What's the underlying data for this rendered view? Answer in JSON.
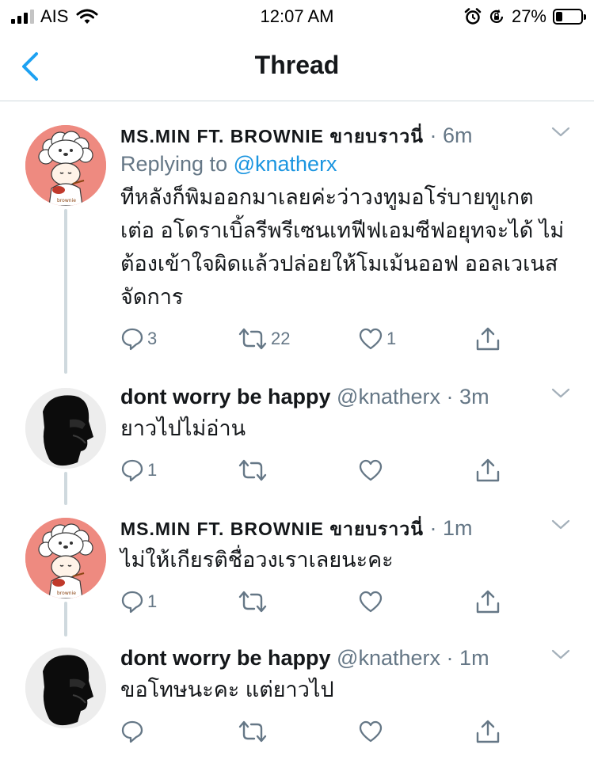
{
  "status_bar": {
    "carrier": "AIS",
    "time": "12:07 AM",
    "battery": "27%",
    "battery_level": 0.27
  },
  "nav": {
    "title": "Thread"
  },
  "tweets": [
    {
      "name": "MS.MIN FT. BROWNIE ขายบราวนี่",
      "handle": "",
      "separator": "·",
      "time": "6m",
      "replying_prefix": "Replying to ",
      "replying_to": "@knatherx",
      "text": "ทีหลังก็พิมออกมาเลยค่ะว่าวงทูมอโร่บายทูเกต เต่อ อโดราเบิ้ลรีพรีเซนเทฟีฟเอมซีฟอยุทจะได้ ไม่ต้องเข้าใจผิดแล้วปล่อยให้โมเม้นออฟ ออลเวเนสจัดการ",
      "replies": "3",
      "retweets": "22",
      "likes": "1",
      "avatar": "brownie-chef-avatar"
    },
    {
      "name": "dont worry be happy",
      "handle": "@knatherx",
      "separator": "·",
      "time": "3m",
      "text": "ยาวไปไม่อ่าน",
      "replies": "1",
      "retweets": "",
      "likes": "",
      "avatar": "dark-profile-avatar"
    },
    {
      "name": "MS.MIN FT. BROWNIE ขายบราวนี่",
      "handle": "",
      "separator": "·",
      "time": "1m",
      "text": "ไม่ให้เกียรติชื่อวงเราเลยนะคะ",
      "replies": "1",
      "retweets": "",
      "likes": "",
      "avatar": "brownie-chef-avatar"
    },
    {
      "name": "dont worry be happy",
      "handle": "@knatherx",
      "separator": "·",
      "time": "1m",
      "text": "ขอโทษนะคะ แต่ยาวไป",
      "replies": "",
      "retweets": "",
      "likes": "",
      "avatar": "dark-profile-avatar"
    }
  ],
  "colors": {
    "accent": "#1da1f2",
    "text_secondary": "#657786",
    "divider": "#cfd9de"
  }
}
